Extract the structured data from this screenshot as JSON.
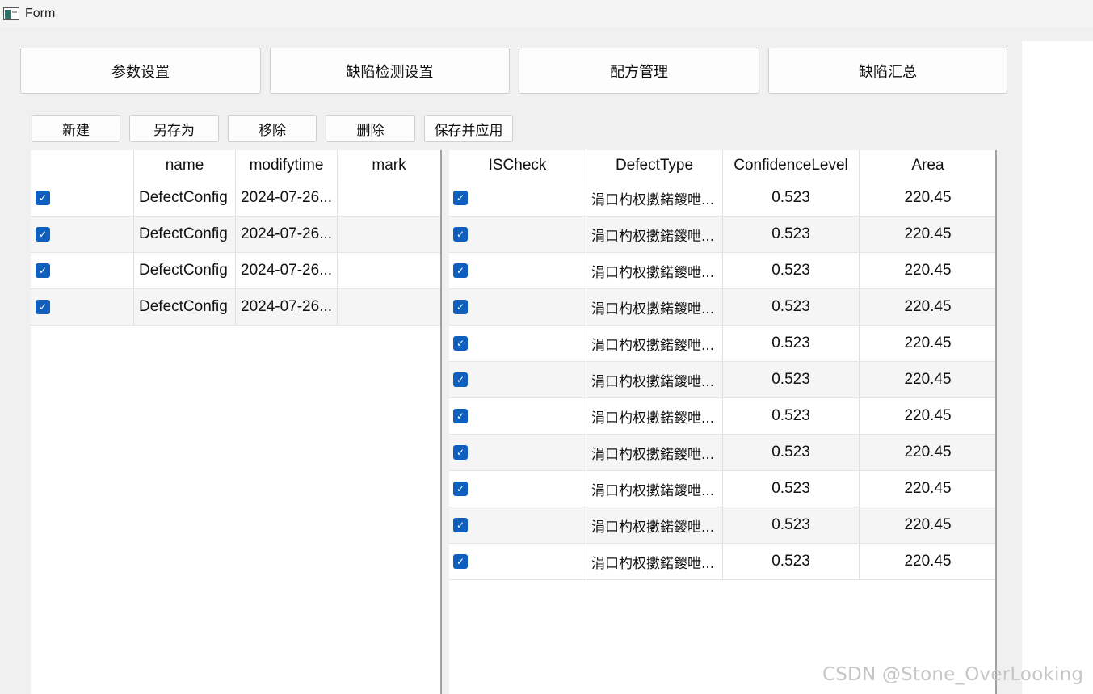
{
  "window": {
    "title": "Form"
  },
  "tabs": [
    {
      "label": "参数设置"
    },
    {
      "label": "缺陷检测设置"
    },
    {
      "label": "配方管理"
    },
    {
      "label": "缺陷汇总"
    }
  ],
  "toolbar": {
    "new_label": "新建",
    "save_as_label": "另存为",
    "move_label": "移除",
    "delete_label": "删除",
    "save_apply_label": "保存并应用"
  },
  "config_table": {
    "headers": [
      "",
      "name",
      "modifytime",
      "mark"
    ],
    "rows": [
      {
        "checked": true,
        "name": "DefectConfig",
        "modifytime": "2024-07-26...",
        "mark": ""
      },
      {
        "checked": true,
        "name": "DefectConfig",
        "modifytime": "2024-07-26...",
        "mark": ""
      },
      {
        "checked": true,
        "name": "DefectConfig",
        "modifytime": "2024-07-26...",
        "mark": ""
      },
      {
        "checked": true,
        "name": "DefectConfig",
        "modifytime": "2024-07-26...",
        "mark": ""
      }
    ]
  },
  "defect_table": {
    "headers": [
      "ISCheck",
      "DefectType",
      "ConfidenceLevel",
      "Area"
    ],
    "rows": [
      {
        "checked": true,
        "defect_type": "涓口杓权擻鍩鍐呭...",
        "confidence": "0.523",
        "area": "220.45"
      },
      {
        "checked": true,
        "defect_type": "涓口杓权擻鍩鍐呭...",
        "confidence": "0.523",
        "area": "220.45"
      },
      {
        "checked": true,
        "defect_type": "涓口杓权擻鍩鍐呭...",
        "confidence": "0.523",
        "area": "220.45"
      },
      {
        "checked": true,
        "defect_type": "涓口杓权擻鍩鍐呭...",
        "confidence": "0.523",
        "area": "220.45"
      },
      {
        "checked": true,
        "defect_type": "涓口杓权擻鍩鍐呭...",
        "confidence": "0.523",
        "area": "220.45"
      },
      {
        "checked": true,
        "defect_type": "涓口杓权擻鍩鍐呭...",
        "confidence": "0.523",
        "area": "220.45"
      },
      {
        "checked": true,
        "defect_type": "涓口杓权擻鍩鍐呭...",
        "confidence": "0.523",
        "area": "220.45"
      },
      {
        "checked": true,
        "defect_type": "涓口杓权擻鍩鍐呭...",
        "confidence": "0.523",
        "area": "220.45"
      },
      {
        "checked": true,
        "defect_type": "涓口杓权擻鍩鍐呭...",
        "confidence": "0.523",
        "area": "220.45"
      },
      {
        "checked": true,
        "defect_type": "涓口杓权擻鍩鍐呭...",
        "confidence": "0.523",
        "area": "220.45"
      },
      {
        "checked": true,
        "defect_type": "涓口杓权擻鍩鍐呭...",
        "confidence": "0.523",
        "area": "220.45"
      }
    ]
  },
  "watermark": "CSDN @Stone_OverLooking",
  "colors": {
    "checkbox": "#0f5fbf",
    "background": "#f0f0f0",
    "row_alt": "#f5f5f5"
  }
}
